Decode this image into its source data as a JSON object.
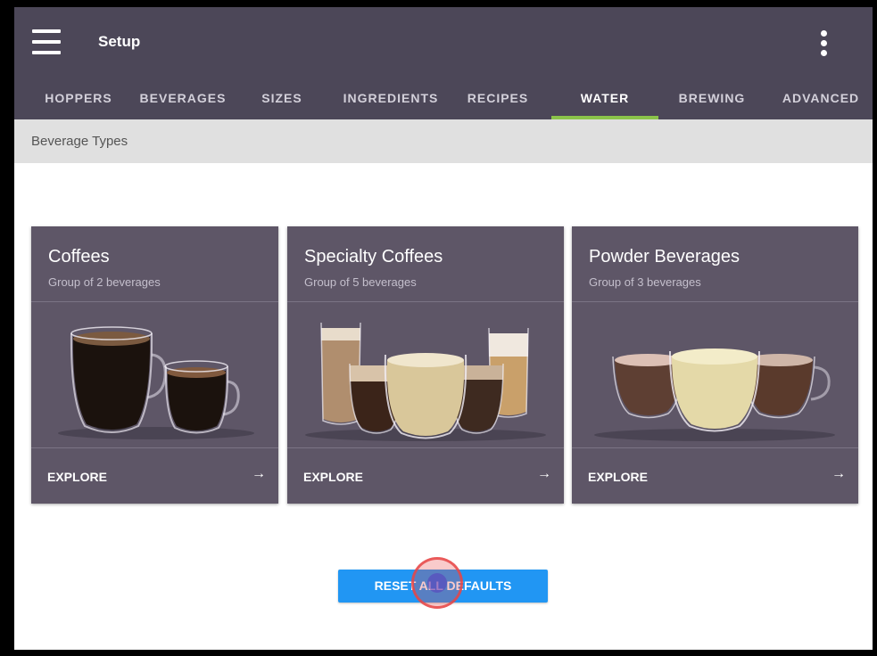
{
  "appbar": {
    "title": "Setup"
  },
  "tabs": [
    {
      "label": "HOPPERS"
    },
    {
      "label": "BEVERAGES"
    },
    {
      "label": "SIZES"
    },
    {
      "label": "INGREDIENTS"
    },
    {
      "label": "RECIPES"
    },
    {
      "label": "WATER",
      "active": true
    },
    {
      "label": "BREWING"
    },
    {
      "label": "ADVANCED"
    }
  ],
  "subheader": {
    "label": "Beverage Types"
  },
  "cards": [
    {
      "title": "Coffees",
      "subtitle": "Group of 2 beverages",
      "action": "EXPLORE",
      "arrow": "→"
    },
    {
      "title": "Specialty Coffees",
      "subtitle": "Group of 5 beverages",
      "action": "EXPLORE",
      "arrow": "→"
    },
    {
      "title": "Powder Beverages",
      "subtitle": "Group of 3 beverages",
      "action": "EXPLORE",
      "arrow": "→"
    }
  ],
  "reset_button": {
    "label": "RESET ALL DEFAULTS"
  },
  "colors": {
    "appbar": "#4c4758",
    "card": "#5e5667",
    "tab_indicator": "#8bc34a",
    "button": "#2196f3",
    "click_marker": "#e84646"
  }
}
